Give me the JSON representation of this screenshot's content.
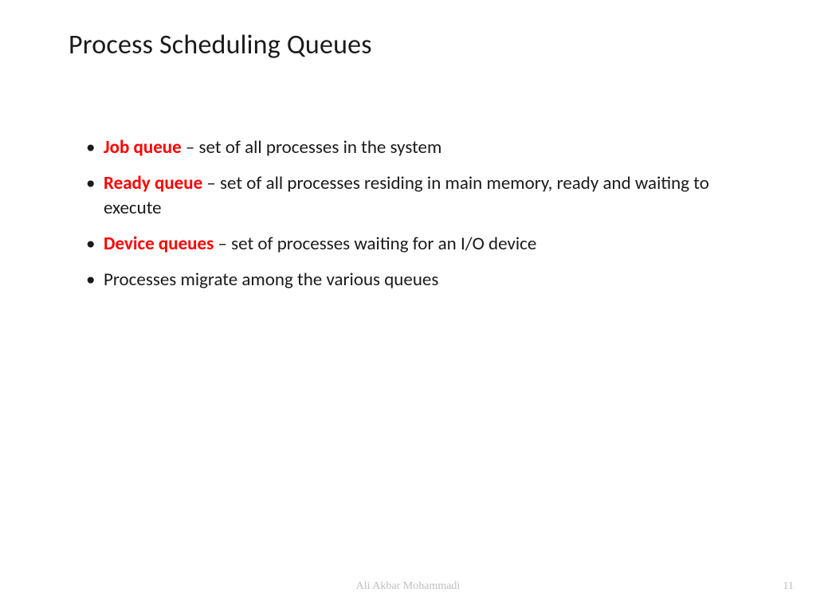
{
  "title": "Process Scheduling Queues",
  "bullets": [
    {
      "term": "Job queue ",
      "desc": "– set of all processes in the system"
    },
    {
      "term": "Ready queue ",
      "desc": "– set of all processes residing in main memory, ready and waiting to execute"
    },
    {
      "term": "Device queues ",
      "desc": "– set of processes waiting for an I/O device"
    },
    {
      "term": "",
      "desc": "Processes migrate among the various queues"
    }
  ],
  "footer": {
    "author": "Ali Akbar Mohammadi",
    "page": "11"
  }
}
